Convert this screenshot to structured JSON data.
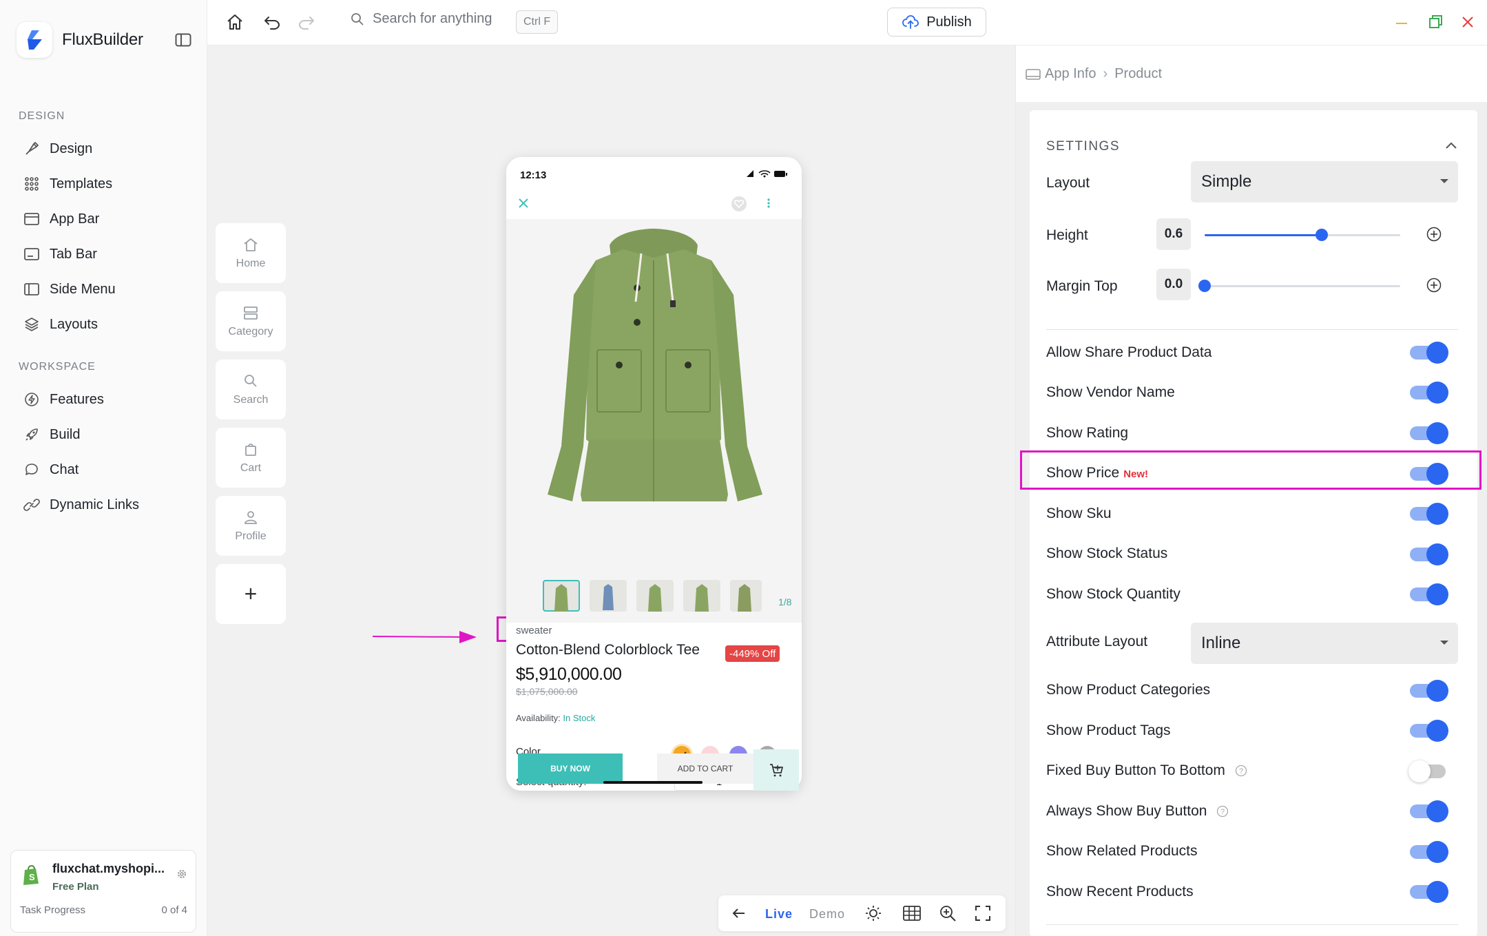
{
  "app": {
    "brand_name": "FluxBuilder"
  },
  "sidebar": {
    "design_section": "DESIGN",
    "design_items": [
      {
        "label": "Design",
        "icon": "brush-icon"
      },
      {
        "label": "Templates",
        "icon": "grid-dots-icon"
      },
      {
        "label": "App Bar",
        "icon": "app-bar-icon"
      },
      {
        "label": "Tab Bar",
        "icon": "tab-bar-icon"
      },
      {
        "label": "Side Menu",
        "icon": "side-menu-icon"
      },
      {
        "label": "Layouts",
        "icon": "layers-icon"
      }
    ],
    "workspace_section": "WORKSPACE",
    "workspace_items": [
      {
        "label": "Features",
        "icon": "lightning-icon"
      },
      {
        "label": "Build",
        "icon": "rocket-icon"
      },
      {
        "label": "Chat",
        "icon": "chat-icon"
      },
      {
        "label": "Dynamic Links",
        "icon": "link-icon"
      }
    ],
    "store": {
      "name": "fluxchat.myshopi...",
      "plan": "Free Plan",
      "task_label": "Task Progress",
      "task_count": "0 of 4"
    }
  },
  "topbar": {
    "search_placeholder": "Search for anything",
    "shortcut": "Ctrl F",
    "publish_label": "Publish"
  },
  "canvas": {
    "tabs": [
      {
        "label": "Home",
        "icon": "home-icon"
      },
      {
        "label": "Category",
        "icon": "category-icon"
      },
      {
        "label": "Search",
        "icon": "search-icon"
      },
      {
        "label": "Cart",
        "icon": "cart-icon"
      },
      {
        "label": "Profile",
        "icon": "profile-icon"
      }
    ],
    "add_tab": "+",
    "bottom_toolbar": {
      "live": "Live",
      "demo": "Demo"
    }
  },
  "phone": {
    "time": "12:13",
    "thumb_counter": "1/8",
    "category": "sweater",
    "title": "Cotton-Blend Colorblock Tee",
    "discount": "-449% Off",
    "price": "$5,910,000.00",
    "old_price": "$1,075,000.00",
    "availability_label": "Availability:",
    "availability_value": "In Stock",
    "color_label": "Color",
    "colors": [
      "#f5a623",
      "#fbd6da",
      "#8c86f0",
      "#a9a9a9"
    ],
    "quantity_label": "Select quantity:",
    "quantity_value": "1",
    "buy_now": "BUY NOW",
    "add_to_cart": "ADD TO CART"
  },
  "panel": {
    "breadcrumb": [
      "App Info",
      "Product"
    ],
    "settings_title": "SETTINGS",
    "layout_label": "Layout",
    "layout_value": "Simple",
    "height_label": "Height",
    "height_value": "0.6",
    "margin_top_label": "Margin Top",
    "margin_top_value": "0.0",
    "attribute_layout_label": "Attribute Layout",
    "attribute_layout_value": "Inline",
    "new_tag": "New!",
    "toggles": [
      {
        "label": "Allow Share Product Data",
        "on": true
      },
      {
        "label": "Show Vendor Name",
        "on": true
      },
      {
        "label": "Show Rating",
        "on": true
      },
      {
        "label": "Show Price",
        "on": true
      },
      {
        "label": "Show Sku",
        "on": true
      },
      {
        "label": "Show Stock Status",
        "on": true
      },
      {
        "label": "Show Stock Quantity",
        "on": true
      },
      {
        "label": "Show Product Categories",
        "on": true
      },
      {
        "label": "Show Product Tags",
        "on": true
      },
      {
        "label": "Fixed Buy Button To Bottom",
        "on": false
      },
      {
        "label": "Always Show Buy Button",
        "on": true
      },
      {
        "label": "Show Related Products",
        "on": true
      },
      {
        "label": "Show Recent Products",
        "on": true
      }
    ]
  },
  "colors": {
    "accent": "#2a66f0",
    "teal": "#3dbfb7",
    "highlight": "#e015c5",
    "discount": "#e44545"
  }
}
